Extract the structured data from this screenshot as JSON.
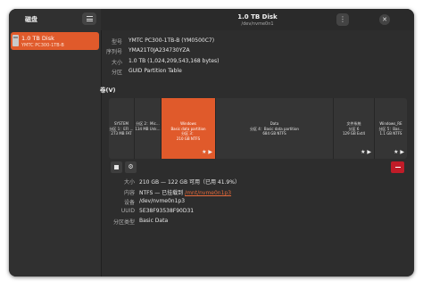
{
  "sidebar": {
    "title": "磁盘",
    "disk": {
      "name": "1.0 TB Disk",
      "model": "YMTC PC300-1TB-B"
    }
  },
  "header": {
    "title": "1.0 TB Disk",
    "subtitle": "/dev/nvme0n1"
  },
  "disk_info": [
    {
      "label": "型号",
      "value": "YMTC PC300-1TB-B (YM0500C7)"
    },
    {
      "label": "序列号",
      "value": "YMA21T0JA234730YZA"
    },
    {
      "label": "大小",
      "value": "1.0 TB (1,024,209,543,168 bytes)"
    },
    {
      "label": "分区",
      "value": "GUID Partition Table"
    }
  ],
  "volumes_title": "卷(V)",
  "partitions": [
    {
      "label": "SYSTEM\n分区 1：EFI …\n273 MB FAT",
      "icons": ""
    },
    {
      "label": "分区 2：Mic…\n134 MB Unk…",
      "icons": ""
    },
    {
      "label": "Windows\nBasic data partition\n分区 3：\n210 GB NTFS",
      "icons": "★ ▶"
    },
    {
      "label": "Data\n分区 4：Basic data partition\n684 GB NTFS",
      "icons": ""
    },
    {
      "label": "文件系统\n分区 6\n129 GB Ext4",
      "icons": "★ ▶"
    },
    {
      "label": "Windows_RE\n分区 5：Bas…\n1.1 GB NTFS",
      "icons": "★ ▶"
    }
  ],
  "volume_info": {
    "size": {
      "label": "大小",
      "value": "210 GB — 122 GB 可用（已用 41.9%）"
    },
    "content": {
      "label": "内容",
      "prefix": "NTFS — 已挂载到",
      "link": "/mnt/nvme0n1p3"
    },
    "device": {
      "label": "设备",
      "value": "/dev/nvme0n1p3"
    },
    "uuid": {
      "label": "UUID",
      "value": "5E38F93538F90D31"
    },
    "type": {
      "label": "分区类型",
      "value": "Basic Data"
    }
  },
  "icons": {
    "menu": "hamburger-icon",
    "more": "more-vert-icon",
    "close": "close-icon",
    "stop": "stop-icon",
    "gear": "gear-icon",
    "delete": "minus-icon",
    "accent": "#e05a2b",
    "danger": "#c01c28"
  }
}
